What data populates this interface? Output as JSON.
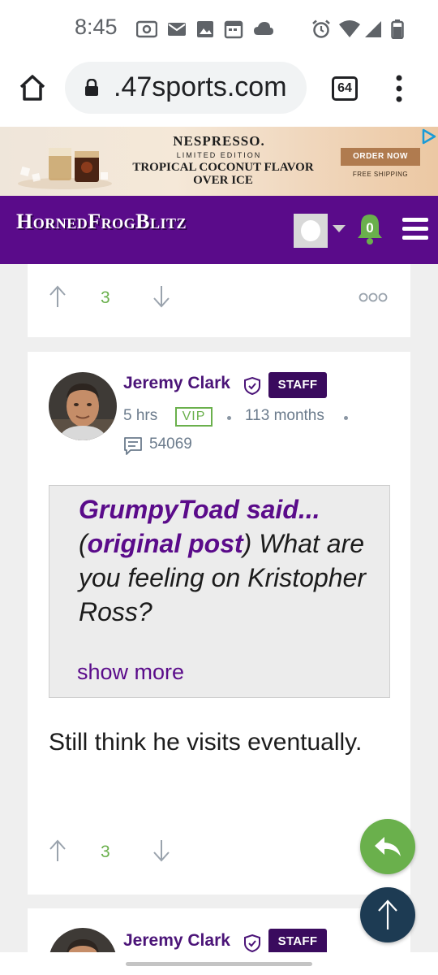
{
  "status_bar": {
    "time": "8:45",
    "icons": [
      "radio-icon",
      "mail-icon",
      "image-icon",
      "calendar-icon",
      "cloud-icon",
      "alarm-icon",
      "wifi-icon",
      "signal-icon",
      "battery-icon"
    ]
  },
  "browser": {
    "url": ".47sports.com",
    "tab_count": "64"
  },
  "ad": {
    "brand": "NESPRESSO.",
    "subtitle": "LIMITED EDITION",
    "headline_line1": "TROPICAL COCONUT FLAVOR",
    "headline_line2": "OVER ICE",
    "cta": "ORDER NOW",
    "shipping": "FREE SHIPPING"
  },
  "site": {
    "logo": "HornedFrogBlitz",
    "notification_count": "0"
  },
  "prev_post": {
    "vote_count": "3"
  },
  "post": {
    "author": "Jeremy Clark",
    "role_badge": "STAFF",
    "time_ago": "5 hrs",
    "vip_badge": "VIP",
    "tenure": "113 months",
    "post_count": "54069",
    "quote": {
      "author": "GrumpyToad said...",
      "open_paren": "(",
      "link": "original post",
      "close_paren": ")",
      "text": " What are you feeling on Kristopher Ross?",
      "show_more": "show more"
    },
    "body": "Still think he visits eventually.",
    "vote_count": "3"
  },
  "next_post": {
    "author": "Jeremy Clark",
    "role_badge": "STAFF"
  },
  "colors": {
    "brand_purple": "#5a0b8a",
    "accent_green": "#6ab04c",
    "fab_navy": "#1d3b53"
  }
}
